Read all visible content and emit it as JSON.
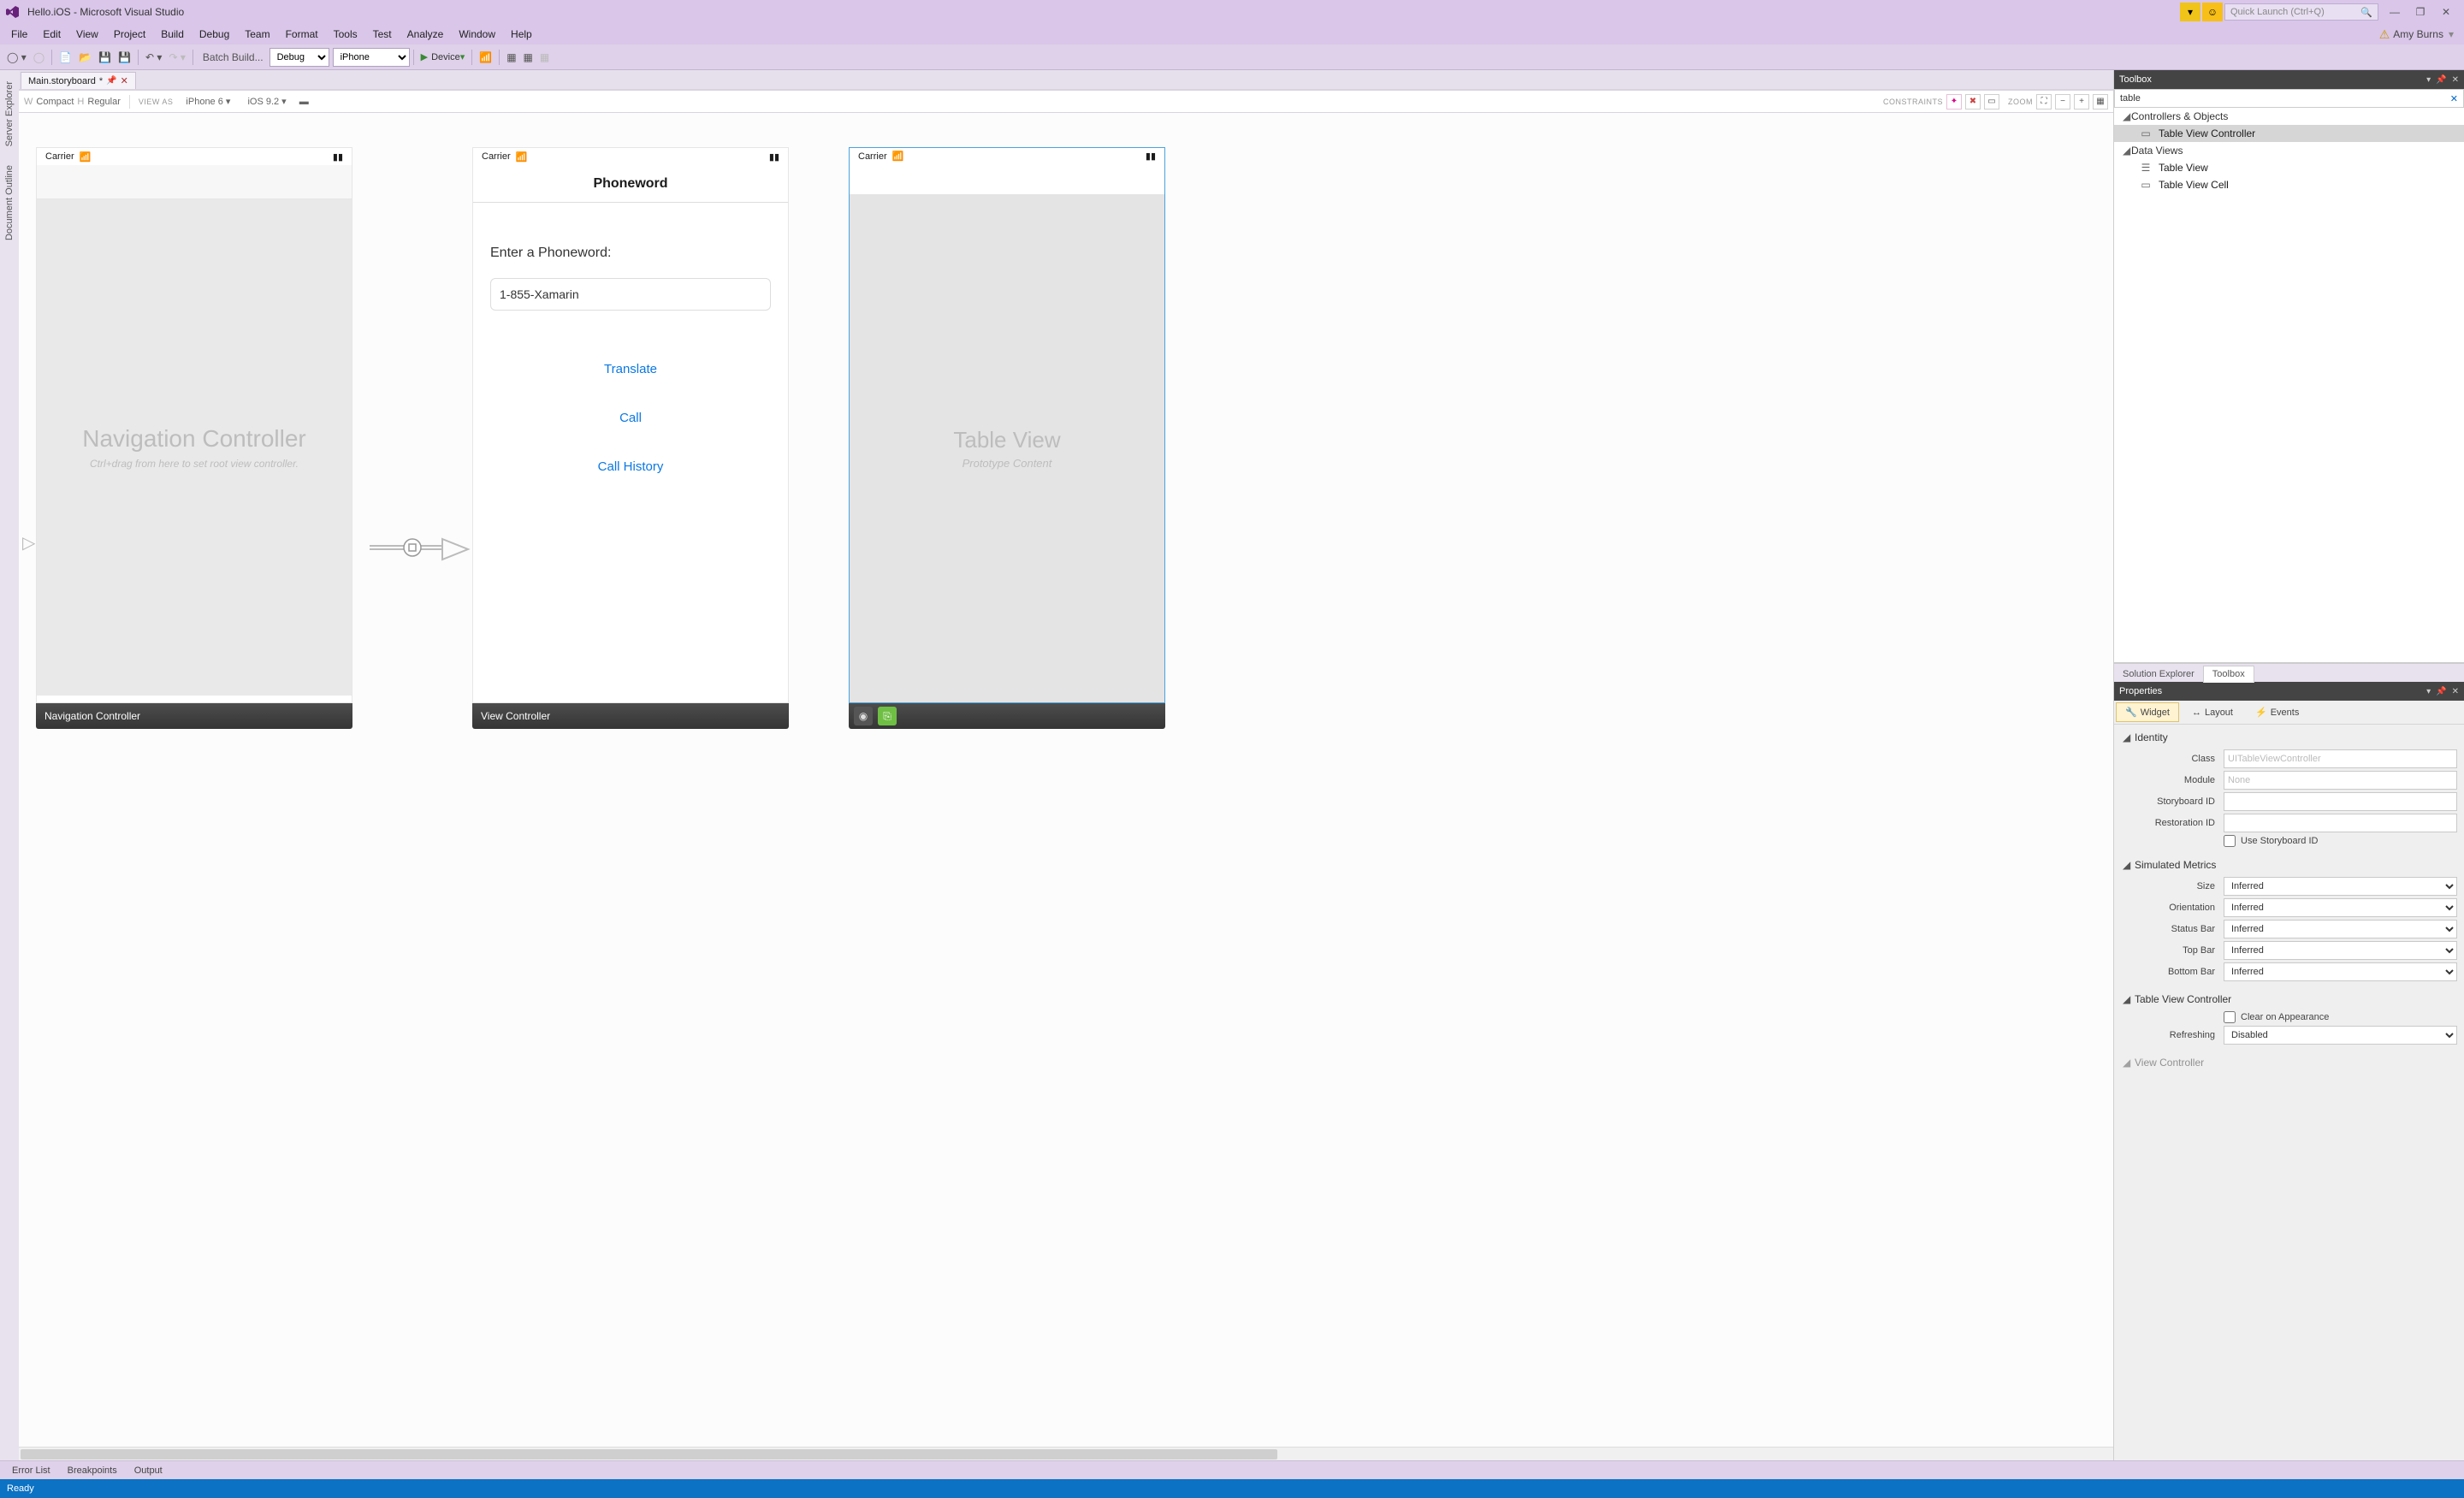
{
  "titlebar": {
    "title": "Hello.iOS - Microsoft Visual Studio",
    "quick_launch_placeholder": "Quick Launch (Ctrl+Q)"
  },
  "user": {
    "name": "Amy Burns"
  },
  "menu": {
    "file": "File",
    "edit": "Edit",
    "view": "View",
    "project": "Project",
    "build": "Build",
    "debug": "Debug",
    "team": "Team",
    "format": "Format",
    "tools": "Tools",
    "test": "Test",
    "analyze": "Analyze",
    "window": "Window",
    "help": "Help"
  },
  "toolbar": {
    "batch_build": "Batch Build...",
    "config": "Debug",
    "platform": "iPhone",
    "device_label": "Device"
  },
  "side_tabs": {
    "server_explorer": "Server Explorer",
    "document_outline": "Document Outline"
  },
  "doc_tab": {
    "name": "Main.storyboard",
    "dirty": "*"
  },
  "designer_bar": {
    "size_class_w": "W",
    "size_class_compact": "Compact ",
    "size_class_h": "H",
    "size_class_regular": "Regular",
    "view_as": "VIEW AS",
    "device": "iPhone 6",
    "os": "iOS 9.2",
    "constraints": "CONSTRAINTS",
    "zoom": "ZOOM"
  },
  "scenes": {
    "nav": {
      "carrier": "Carrier",
      "title": "Navigation Controller",
      "hint": "Ctrl+drag from here to set root view controller.",
      "footer": "Navigation Controller"
    },
    "phoneword": {
      "carrier": "Carrier",
      "nav_title": "Phoneword",
      "label": "Enter a Phoneword:",
      "input_value": "1-855-Xamarin",
      "btn_translate": "Translate",
      "btn_call": "Call",
      "btn_history": "Call History",
      "footer": "View Controller"
    },
    "tableview": {
      "carrier": "Carrier",
      "title": "Table View",
      "subtitle": "Prototype Content"
    }
  },
  "toolbox": {
    "title": "Toolbox",
    "search_value": "table",
    "group1": "Controllers & Objects",
    "item_tvc": "Table View Controller",
    "group2": "Data Views",
    "item_tv": "Table View",
    "item_tvcell": "Table View Cell"
  },
  "panel_tabs": {
    "solution_explorer": "Solution Explorer",
    "toolbox": "Toolbox"
  },
  "properties": {
    "title": "Properties",
    "tab_widget": "Widget",
    "tab_layout": "Layout",
    "tab_events": "Events",
    "sec_identity": "Identity",
    "lbl_class": "Class",
    "ph_class": "UITableViewController",
    "lbl_module": "Module",
    "ph_module": "None",
    "lbl_storyboard_id": "Storyboard ID",
    "lbl_restoration_id": "Restoration ID",
    "chk_use_storyboard_id": "Use Storyboard ID",
    "sec_simulated": "Simulated Metrics",
    "lbl_size": "Size",
    "val_size": "Inferred",
    "lbl_orientation": "Orientation",
    "val_orientation": "Inferred",
    "lbl_status_bar": "Status Bar",
    "val_status_bar": "Inferred",
    "lbl_top_bar": "Top Bar",
    "val_top_bar": "Inferred",
    "lbl_bottom_bar": "Bottom Bar",
    "val_bottom_bar": "Inferred",
    "sec_tvc": "Table View Controller",
    "chk_clear_on_appearance": "Clear on Appearance",
    "lbl_refreshing": "Refreshing",
    "val_refreshing": "Disabled",
    "sec_viewcontroller": "View Controller"
  },
  "bottom": {
    "error_list": "Error List",
    "breakpoints": "Breakpoints",
    "output": "Output"
  },
  "status": {
    "ready": "Ready"
  }
}
